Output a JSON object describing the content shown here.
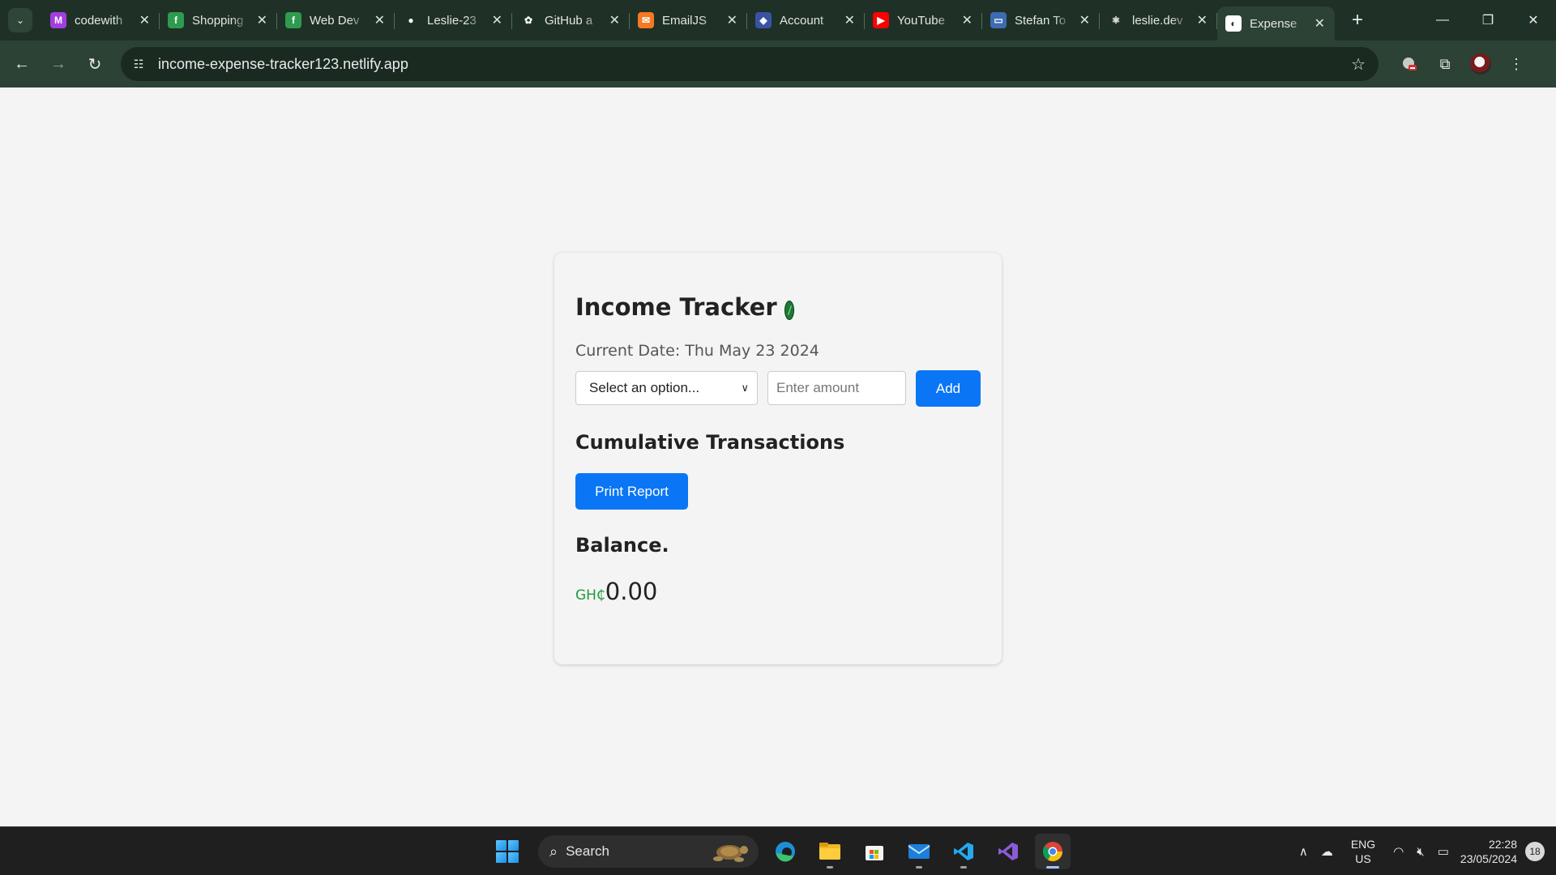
{
  "browser": {
    "tab_search_glyph": "⌄",
    "tabs": [
      {
        "title": "codewith",
        "icon": "codewithmosh-icon",
        "color": "#a33de0",
        "glyph": "M",
        "active": false
      },
      {
        "title": "Shopping",
        "icon": "freecodecamp-icon",
        "color": "#2e9c4e",
        "glyph": "f",
        "active": false
      },
      {
        "title": "Web Dev",
        "icon": "freecodecamp-icon",
        "color": "#2e9c4e",
        "glyph": "f",
        "active": false
      },
      {
        "title": "Leslie-23",
        "icon": "github-icon",
        "color": "#1f3127",
        "glyph": "●",
        "active": false
      },
      {
        "title": "GitHub a",
        "icon": "openai-icon",
        "color": "#1f3127",
        "glyph": "✿",
        "active": false
      },
      {
        "title": "EmailJS",
        "icon": "emailjs-icon",
        "color": "#f47a20",
        "glyph": "✉",
        "active": false
      },
      {
        "title": "Account",
        "icon": "vercel-icon",
        "color": "#3953a4",
        "glyph": "◆",
        "active": false
      },
      {
        "title": "YouTube",
        "icon": "youtube-icon",
        "color": "#ff0000",
        "glyph": "▶",
        "active": false
      },
      {
        "title": "Stefan To",
        "icon": "laptop-icon",
        "color": "#3d6bb3",
        "glyph": "▭",
        "active": false
      },
      {
        "title": "leslie.dev",
        "icon": "react-icon",
        "color": "#1f3127",
        "glyph": "⚛",
        "active": false
      },
      {
        "title": "Expense",
        "icon": "netlify-icon",
        "color": "#ffffff",
        "glyph": "◐",
        "active": true
      }
    ],
    "new_tab": "+",
    "window_controls": {
      "minimize": "—",
      "restore": "❐",
      "close": "✕"
    },
    "nav": {
      "back": "←",
      "forward": "→",
      "reload": "↻"
    },
    "url": "income-expense-tracker123.netlify.app",
    "site_info_glyph": "☷",
    "star_glyph": "☆",
    "extensions_glyph": "⧉",
    "menu_glyph": "⋮"
  },
  "app": {
    "title": "Income Tracker",
    "current_date": "Current Date: Thu May 23 2024",
    "select": {
      "selected": "Select an option..."
    },
    "amount_input": {
      "placeholder": "Enter amount",
      "value": ""
    },
    "add_label": "Add",
    "cumulative_title": "Cumulative Transactions",
    "print_label": "Print Report",
    "balance_title": "Balance.",
    "balance_currency": "GH₵",
    "balance_amount": "0.00",
    "accent_color": "#0a76f5",
    "currency_color": "#1f9a3a"
  },
  "taskbar": {
    "search_label": "Search",
    "apps": [
      "edge-icon",
      "file-explorer-icon",
      "microsoft-store-icon",
      "mail-icon",
      "vscode-icon",
      "visual-studio-icon",
      "chrome-icon"
    ],
    "lang_line1": "ENG",
    "lang_line2": "US",
    "time": "22:28",
    "date": "23/05/2024",
    "notifications": "18"
  }
}
